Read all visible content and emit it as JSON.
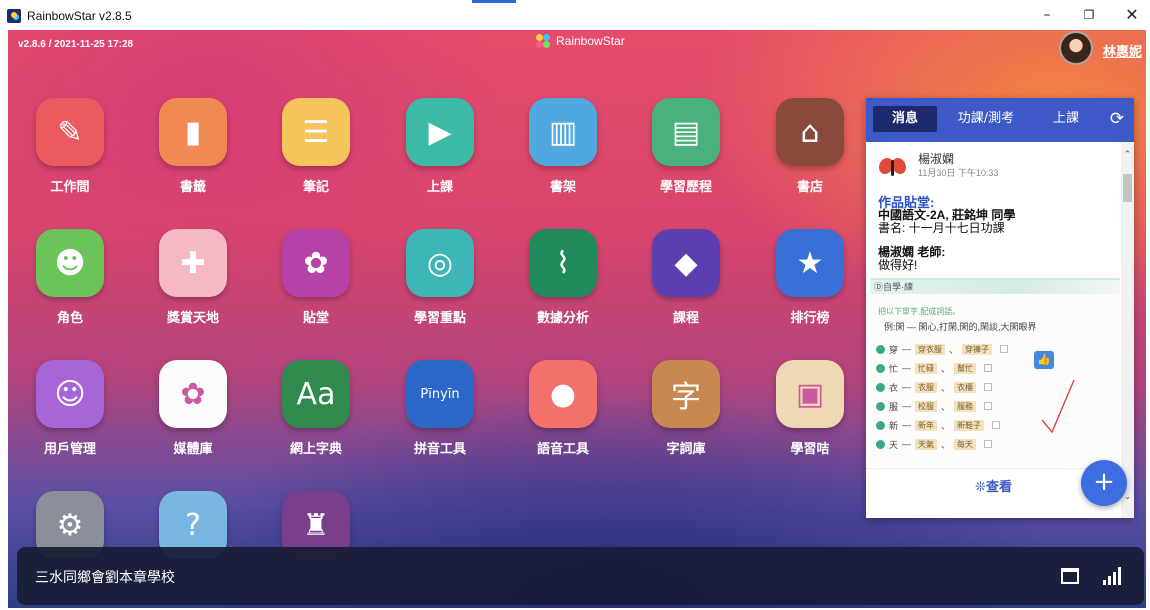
{
  "window": {
    "title": "RainbowStar v2.8.5",
    "minimize": "–",
    "restore": "❐",
    "close": "✕"
  },
  "header": {
    "version": "v2.8.6 / 2021-11-25 17:28",
    "brand": "RainbowStar",
    "user_name": "林惠妮"
  },
  "apps": [
    {
      "label": "工作間",
      "icon": "pencil-icon",
      "color": "#ea5a5f"
    },
    {
      "label": "書籤",
      "icon": "bookmark-icon",
      "color": "#f08a52"
    },
    {
      "label": "筆記",
      "icon": "notepad-icon",
      "color": "#f5c45c"
    },
    {
      "label": "上課",
      "icon": "play-icon",
      "color": "#3dbaa5"
    },
    {
      "label": "書架",
      "icon": "books-icon",
      "color": "#4fa8e0"
    },
    {
      "label": "學習歷程",
      "icon": "stairs-icon",
      "color": "#49b27c"
    },
    {
      "label": "書店",
      "icon": "store-icon",
      "color": "#8a4a3b"
    },
    {
      "label": "角色",
      "icon": "character-icon",
      "color": "#6cc35a"
    },
    {
      "label": "獎賞天地",
      "icon": "gift-icon",
      "color": "#f6b9c4"
    },
    {
      "label": "貼堂",
      "icon": "flower-icon",
      "color": "#b843a8"
    },
    {
      "label": "學習重點",
      "icon": "target-icon",
      "color": "#3eb6b8"
    },
    {
      "label": "數據分析",
      "icon": "chart-icon",
      "color": "#1f8a5a"
    },
    {
      "label": "課程",
      "icon": "graduation-cap-icon",
      "color": "#5b3fb0"
    },
    {
      "label": "排行榜",
      "icon": "medal-icon",
      "color": "#3a6fd8"
    },
    {
      "label": "用戶管理",
      "icon": "users-icon",
      "color": "#a766d8"
    },
    {
      "label": "媒體庫",
      "icon": "media-icon",
      "color": "#fbfbfb"
    },
    {
      "label": "網上字典",
      "icon": "dictionary-icon",
      "color": "#2f8a4e"
    },
    {
      "label": "拼音工具",
      "icon": "keyboard-icon",
      "color": "#2b67c9"
    },
    {
      "label": "語音工具",
      "icon": "microphone-icon",
      "color": "#f2716a"
    },
    {
      "label": "字詞庫",
      "icon": "word-book-icon",
      "color": "#c98850"
    },
    {
      "label": "學習咭",
      "icon": "card-icon",
      "color": "#efd9b4"
    },
    {
      "label": "",
      "icon": "gear-icon",
      "color": "#8a8f99"
    },
    {
      "label": "",
      "icon": "help-icon",
      "color": "#79b6e0"
    },
    {
      "label": "",
      "icon": "school-icon",
      "color": "#7a3f8c"
    }
  ],
  "panel": {
    "tabs": [
      "消息",
      "功課/測考",
      "上課"
    ],
    "message": {
      "sender": "楊淑嫻",
      "time": "11月30日 下午10:33",
      "title": "作品貼堂:",
      "line1": "中國語文-2A, 莊銘坤 同學",
      "line2": "書名: 十一月十七日功課",
      "line3": "楊淑嫻 老師:",
      "line4": "做得好!"
    },
    "worksheet": {
      "title": "Ⓓ自學·練",
      "instruction": "把以下單字,配成詞語。",
      "example": "例:閑 — 閑心,打閑,閑的,閑談,大閑眼界",
      "rows": [
        {
          "char": "穿",
          "a": "穿衣服",
          "b": "穿褲子"
        },
        {
          "char": "忙",
          "a": "忙碌",
          "b": "幫忙"
        },
        {
          "char": "衣",
          "a": "衣服",
          "b": "衣櫃"
        },
        {
          "char": "服",
          "a": "校服",
          "b": "服務"
        },
        {
          "char": "新",
          "a": "新年",
          "b": "新鞋子"
        },
        {
          "char": "天",
          "a": "天氣",
          "b": "每天"
        }
      ]
    },
    "view_label": "❊查看",
    "fab": "+"
  },
  "footer": {
    "school": "三水同鄉會劉本章學校"
  }
}
